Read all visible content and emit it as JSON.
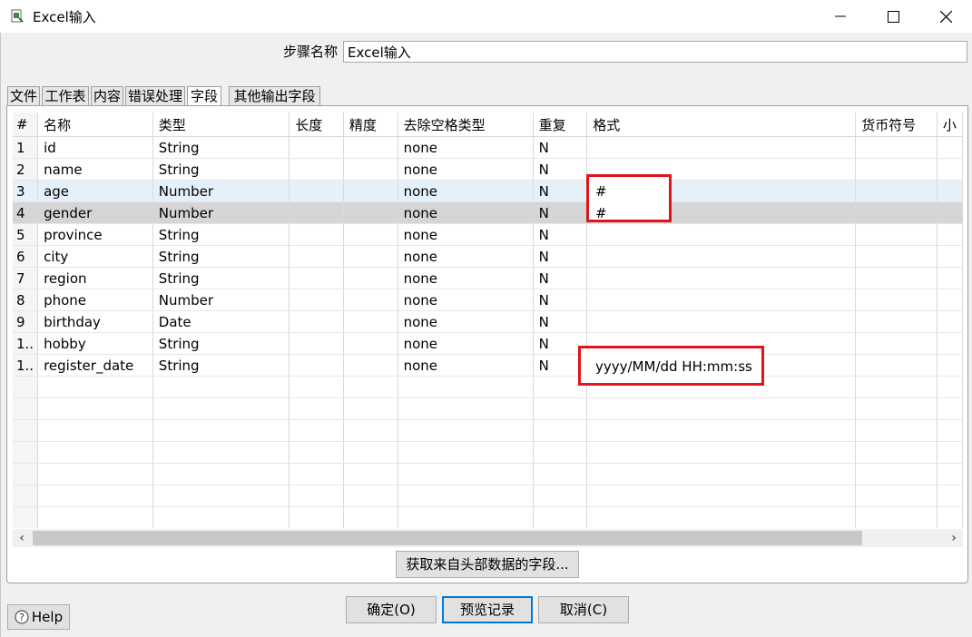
{
  "window": {
    "title": "Excel输入"
  },
  "step": {
    "label": "步骤名称",
    "value": "Excel输入"
  },
  "tabs": [
    "文件",
    "工作表",
    "内容",
    "错误处理",
    "字段",
    "其他输出字段"
  ],
  "table": {
    "columns": [
      "#",
      "名称",
      "类型",
      "长度",
      "精度",
      "去除空格类型",
      "重复",
      "格式",
      "货币符号",
      "小"
    ],
    "rows": [
      [
        "1",
        "id",
        "String",
        "",
        "",
        "none",
        "N",
        ""
      ],
      [
        "2",
        "name",
        "String",
        "",
        "",
        "none",
        "N",
        ""
      ],
      [
        "3",
        "age",
        "Number",
        "",
        "",
        "none",
        "N",
        "#"
      ],
      [
        "4",
        "gender",
        "Number",
        "",
        "",
        "none",
        "N",
        "#"
      ],
      [
        "5",
        "province",
        "String",
        "",
        "",
        "none",
        "N",
        ""
      ],
      [
        "6",
        "city",
        "String",
        "",
        "",
        "none",
        "N",
        ""
      ],
      [
        "7",
        "region",
        "String",
        "",
        "",
        "none",
        "N",
        ""
      ],
      [
        "8",
        "phone",
        "Number",
        "",
        "",
        "none",
        "N",
        ""
      ],
      [
        "9",
        "birthday",
        "Date",
        "",
        "",
        "none",
        "N",
        ""
      ],
      [
        "1..",
        "hobby",
        "String",
        "",
        "",
        "none",
        "N",
        ""
      ],
      [
        "1..",
        "register_date",
        "String",
        "",
        "",
        "none",
        "N",
        "yyyy/MM/dd HH:mm:ss"
      ]
    ]
  },
  "buttons": {
    "get_fields": "获取来自头部数据的字段...",
    "ok": "确定(O)",
    "preview": "预览记录",
    "cancel": "取消(C)",
    "help": "Help"
  },
  "colors": {
    "highlight": "#e0141e",
    "selected_row": "#e6f0fb",
    "default_button_border": "#0078d7"
  }
}
